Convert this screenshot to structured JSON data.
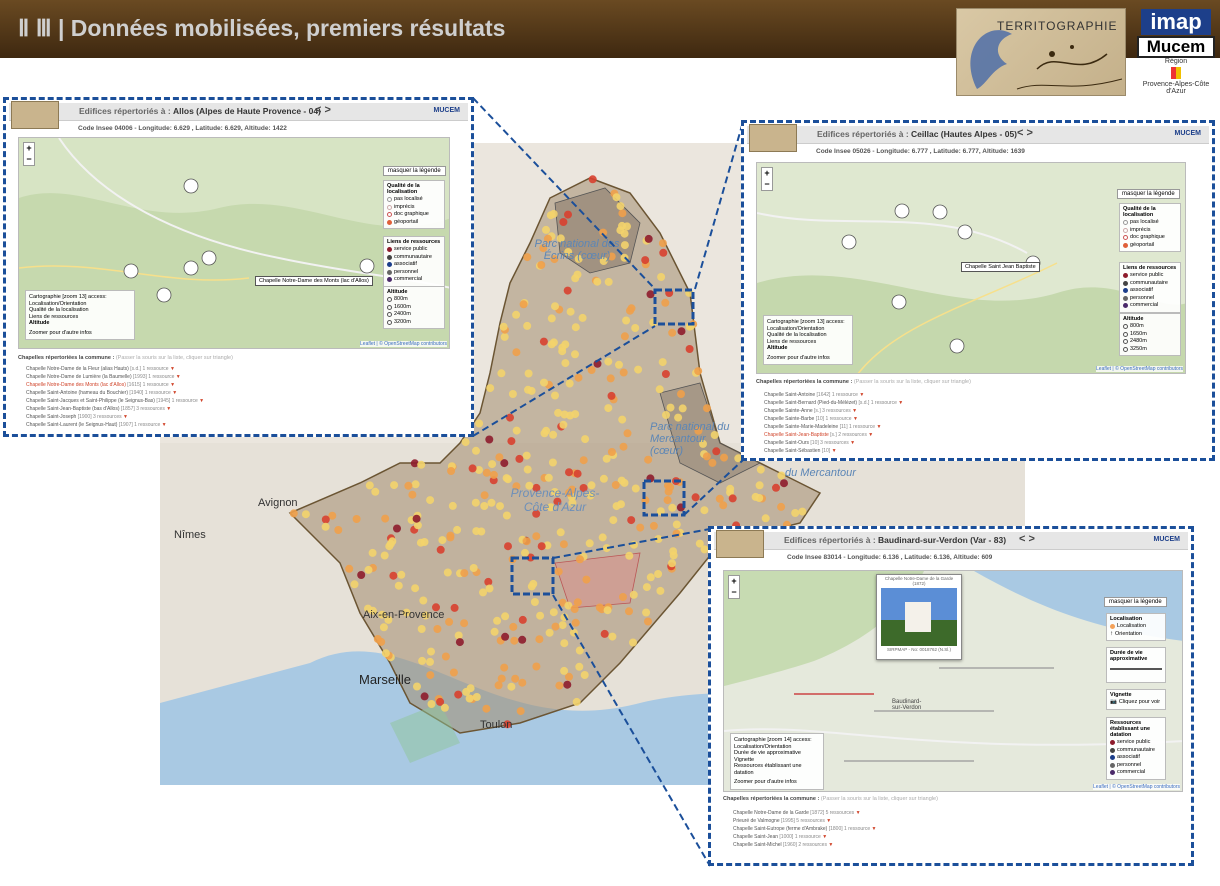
{
  "header": {
    "title": "Ⅱ Ⅲ | Données mobilisées, premiers résultats",
    "logo_territographie": "TERRITOGRAPHIE",
    "logo_imap": "imap",
    "logo_mucem": "Mucem",
    "logo_region_top": "Région",
    "logo_region_bottom": "Provence-Alpes-Côte d'Azur"
  },
  "main_map": {
    "labels": {
      "parc_ecrins": "Parc national des Écrins (cœur)",
      "parc_mercantour": "Parc national du Mercantour (cœur)",
      "du_mercantour": "du Mercantour",
      "paca": "Provence-Alpes-Côte d'Azur",
      "avignon": "Avignon",
      "nimes": "Nîmes",
      "aix": "Aix-en-Provence",
      "marseille": "Marseille",
      "toulon": "Toulon"
    },
    "colors": {
      "yellow": "#f3d36b",
      "orange": "#f0a04a",
      "red": "#d8402f",
      "darkred": "#8e1c2c",
      "region": "#a08a6c",
      "highlight": "#1b4f9a"
    }
  },
  "panels": {
    "allos": {
      "title_prefix": "Edifices répertoriés à :",
      "title_place": "Allos (Alpes de Haute Provence - 04)",
      "arrows": "< >",
      "brand": "MUCEM",
      "code": "Code Insee 04006 - Longitude: 6.629 , Latitude: 6.629, Altitude: 1422",
      "legend_button": "masquer la légende",
      "legend_quality_title": "Qualité de la localisation",
      "legend_quality": [
        "pas localisé",
        "imprécis",
        "doc graphique",
        "géoportail"
      ],
      "legend_links_title": "Liens de ressources",
      "legend_links": [
        "service public",
        "communautaire",
        "associatif",
        "personnel",
        "commercial"
      ],
      "legend_alt_title": "Altitude",
      "legend_alt": [
        "800m",
        "1600m",
        "2400m",
        "3200m"
      ],
      "tooltip": "Chapelle Notre-Dame des Monts (lac d'Allos)",
      "info_lines": [
        "Cartographie [zoom 13] access:",
        "Localisation/Orientation",
        "Qualité de la localisation",
        "Liens de ressources",
        "Altitude",
        "",
        "Zoomer pour d'autre infos"
      ],
      "attribution": "Leaflet | © OpenStreetMap contributors",
      "list_title": "Chapelles répertoriées la commune :",
      "list_hint": "(Passer la souris sur la liste, cliquer sur triangle)",
      "items": [
        {
          "name": "Chapelle Notre-Dame de la Fleur (alias Hauts)",
          "year": "[s.d.]",
          "count": "1 ressource",
          "hl": false
        },
        {
          "name": "Chapelle Notre-Dame de Lumière (la Baumelle)",
          "year": "[1993]",
          "count": "1 ressource",
          "hl": false
        },
        {
          "name": "Chapelle Notre-Dame des Monts (lac d'Allos)",
          "year": "[1615]",
          "count": "1 ressource",
          "hl": true
        },
        {
          "name": "Chapelle Saint-Antoine (hameau du Bouchier)",
          "year": "[1940]",
          "count": "1 ressource",
          "hl": false
        },
        {
          "name": "Chapelle Saint-Jacques et Saint-Philippe (le Seignus-Bas)",
          "year": "[1945]",
          "count": "1 ressource",
          "hl": false
        },
        {
          "name": "Chapelle Saint-Jean-Baptiste (bas d'Allos)",
          "year": "[1857]",
          "count": "3 ressources",
          "hl": false
        },
        {
          "name": "Chapelle Saint-Joseph",
          "year": "[1900]",
          "count": "3 ressources",
          "hl": false
        },
        {
          "name": "Chapelle Saint-Laurent (le Seignus-Haut)",
          "year": "[1907]",
          "count": "1 ressource",
          "hl": false
        }
      ]
    },
    "ceillac": {
      "title_prefix": "Edifices répertoriés à :",
      "title_place": "Ceillac (Hautes Alpes - 05)",
      "arrows": "< >",
      "brand": "MUCEM",
      "code": "Code Insee 05026 - Longitude: 6.777 , Latitude: 6.777, Altitude: 1639",
      "legend_button": "masquer la légende",
      "legend_quality_title": "Qualité de la localisation",
      "legend_quality": [
        "pas localisé",
        "imprécis",
        "doc graphique",
        "géoportail"
      ],
      "legend_links_title": "Liens de ressources",
      "legend_links": [
        "service public",
        "communautaire",
        "associatif",
        "personnel",
        "commercial"
      ],
      "legend_alt_title": "Altitude",
      "legend_alt": [
        "800m",
        "1650m",
        "2480m",
        "3250m"
      ],
      "tooltip": "Chapelle Saint Jean Baptiste",
      "info_lines": [
        "Cartographie [zoom 13] access:",
        "Localisation/Orientation",
        "Qualité de la localisation",
        "Liens de ressources",
        "Altitude",
        "",
        "Zoomer pour d'autre infos"
      ],
      "attribution": "Leaflet | © OpenStreetMap contributors",
      "list_title": "Chapelles répertoriées la commune :",
      "list_hint": "(Passer la souris sur la liste, cliquer sur triangle)",
      "items": [
        {
          "name": "Chapelle Saint-Antoine",
          "year": "[1642]",
          "count": "1 ressource",
          "hl": false
        },
        {
          "name": "Chapelle Saint-Bernard (Pied-du-Mélézet)",
          "year": "[s.d.]",
          "count": "1 ressource",
          "hl": false
        },
        {
          "name": "Chapelle Sainte-Anne",
          "year": "[s.]",
          "count": "3 ressources",
          "hl": false
        },
        {
          "name": "Chapelle Sainte-Barbe",
          "year": "[10]",
          "count": "1 ressource",
          "hl": false
        },
        {
          "name": "Chapelle Sainte-Marie-Madeleine",
          "year": "[11]",
          "count": "1 ressource",
          "hl": false
        },
        {
          "name": "Chapelle Saint-Jean-Baptiste",
          "year": "[s.]",
          "count": "2 ressources",
          "hl": true
        },
        {
          "name": "Chapelle Saint-Ours",
          "year": "[10]",
          "count": "3 ressources",
          "hl": false
        },
        {
          "name": "Chapelle Saint-Sébastien",
          "year": "[10]",
          "count": "",
          "hl": false
        }
      ]
    },
    "baudinard": {
      "title_prefix": "Edifices répertoriés à :",
      "title_place": "Baudinard-sur-Verdon (Var - 83)",
      "arrows": "< >",
      "brand": "MUCEM",
      "code": "Code Insee 83014 - Longitude: 6.136 , Latitude: 6.136, Altitude: 609",
      "legend_button": "masquer la légende",
      "legend_loc_title": "Localisation",
      "legend_loc": [
        "Localisation",
        "Orientation"
      ],
      "legend_duree_title": "Durée de vie approximative",
      "legend_vignette_title": "Vignette",
      "legend_vignette": "Cliquez pour voir",
      "legend_res_title": "Ressources établissant une datation",
      "legend_res": [
        "service public",
        "communautaire",
        "associatif",
        "personnel",
        "commercial"
      ],
      "photo_title": "Chapelle Notre-Dame de la Garde (1872)",
      "photo_caption": "SIRPMAP - No: 0018762 (N.Sl.)",
      "place_label": "Baudinard-sur-Verdon",
      "info_lines": [
        "Cartographie [zoom 14] access:",
        "Localisation/Orientation",
        "Durée de vie approximative",
        "Vignette",
        "Ressources établissant une datation",
        "",
        "Zoomer pour d'autre infos"
      ],
      "attribution": "Leaflet | © OpenStreetMap contributors",
      "list_title": "Chapelles répertoriées la commune :",
      "list_hint": "(Passer la souris sur la liste, cliquer sur triangle)",
      "items": [
        {
          "name": "Chapelle Notre-Dame de la Garde",
          "year": "[1872]",
          "count": "5 ressources",
          "hl": false
        },
        {
          "name": "Prieuré de Valmogne",
          "year": "[1995]",
          "count": "5 ressources",
          "hl": false
        },
        {
          "name": "Chapelle Saint-Eutrope (ferme d'Ambrake)",
          "year": "[1800]",
          "count": "1 ressource",
          "hl": false
        },
        {
          "name": "Chapelle Saint-Jean",
          "year": "[1000]",
          "count": "1 ressource",
          "hl": false
        },
        {
          "name": "Chapelle Saint-Michel",
          "year": "[1960]",
          "count": "2 ressources",
          "hl": false
        }
      ]
    }
  }
}
